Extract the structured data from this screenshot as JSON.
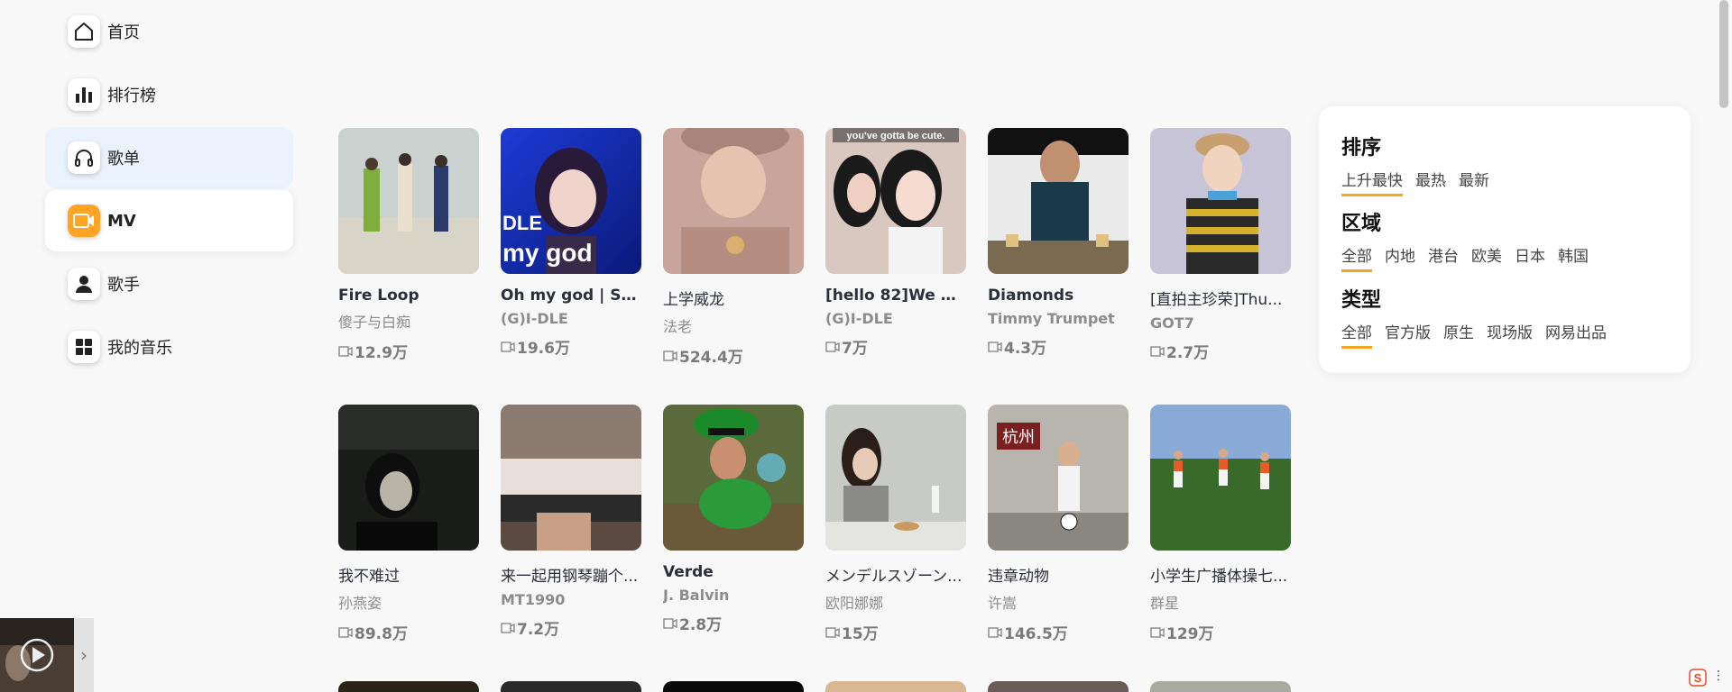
{
  "nav": {
    "items": [
      {
        "label": "首页",
        "icon": "home-icon"
      },
      {
        "label": "排行榜",
        "icon": "bar-chart-icon"
      },
      {
        "label": "歌单",
        "icon": "headphones-icon"
      },
      {
        "label": "MV",
        "icon": "video-icon"
      },
      {
        "label": "歌手",
        "icon": "person-icon"
      },
      {
        "label": "我的音乐",
        "icon": "grid-icon"
      }
    ],
    "active": "MV",
    "hovered": "歌单"
  },
  "cards": [
    {
      "title": "Fire Loop",
      "artist": "傻子与白痴",
      "plays": "12.9万"
    },
    {
      "title": "Oh my god | SBS...",
      "artist": "(G)I-DLE",
      "plays": "19.6万",
      "thumb_text": "DLE\nmy god"
    },
    {
      "title": "上学威龙",
      "artist": "法老",
      "plays": "524.4万"
    },
    {
      "title": "[hello 82]We as...",
      "artist": "(G)I-DLE",
      "plays": "7万",
      "thumb_text": "you've gotta be cute."
    },
    {
      "title": "Diamonds",
      "artist": "Timmy Trumpet",
      "plays": "4.3万"
    },
    {
      "title": "[直拍主珍荣]Thu...",
      "artist": "GOT7",
      "plays": "2.7万"
    },
    {
      "title": "我不难过",
      "artist": "孙燕姿",
      "plays": "89.8万"
    },
    {
      "title": "来一起用钢琴蹦个...",
      "artist": "MT1990",
      "plays": "7.2万"
    },
    {
      "title": "Verde",
      "artist": "J. Balvin",
      "plays": "2.8万"
    },
    {
      "title": "メンデルスゾーン...",
      "artist": "欧阳娜娜",
      "plays": "15万"
    },
    {
      "title": "违章动物",
      "artist": "许嵩",
      "plays": "146.5万",
      "thumb_text": "杭州"
    },
    {
      "title": "小学生广播体操七...",
      "artist": "群星",
      "plays": "129万"
    }
  ],
  "filters": {
    "sort": {
      "heading": "排序",
      "options": [
        "上升最快",
        "最热",
        "最新"
      ],
      "selected": "上升最快"
    },
    "region": {
      "heading": "区域",
      "options": [
        "全部",
        "内地",
        "港台",
        "欧美",
        "日本",
        "韩国"
      ],
      "selected": "全部"
    },
    "type": {
      "heading": "类型",
      "options": [
        "全部",
        "官方版",
        "原生",
        "现场版",
        "网易出品"
      ],
      "selected": "全部"
    }
  },
  "colors": {
    "accent": "#f5a623",
    "mv_icon_bg": "#ffa425",
    "hover_bg": "#eaf3fd"
  },
  "mini_player": {
    "arrow": "›"
  },
  "tray": {
    "more": "⋮"
  }
}
